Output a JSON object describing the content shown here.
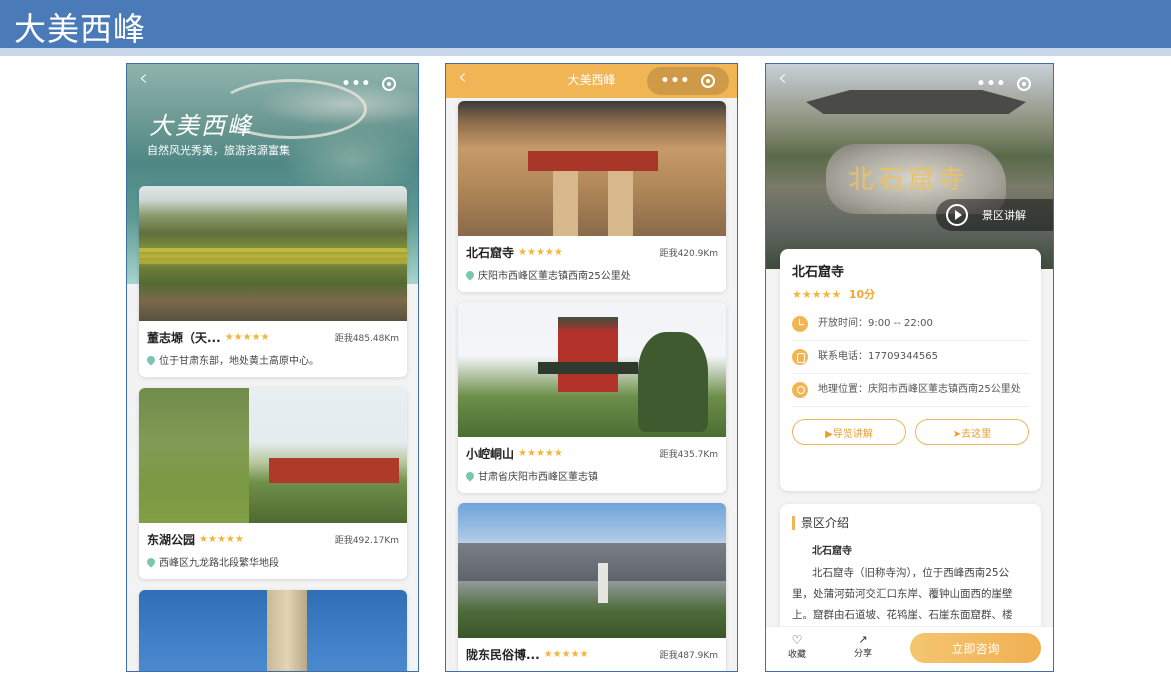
{
  "banner": {
    "title": "大美西峰"
  },
  "phone1": {
    "hero_title": "大美西峰",
    "hero_subtitle": "自然风光秀美，旅游资源富集",
    "menu_dots": "•••",
    "spots": [
      {
        "name": "董志塬（天...",
        "stars": "★★★★★",
        "distance": "距我485.48Km",
        "address": "位于甘肃东部，地处黄土高原中心。"
      },
      {
        "name": "东湖公园",
        "stars": "★★★★★",
        "distance": "距我492.17Km",
        "address": "西峰区九龙路北段繁华地段"
      }
    ]
  },
  "phone2": {
    "nav_title": "大美西峰",
    "menu_dots": "•••",
    "spots": [
      {
        "name": "北石窟寺",
        "stars": "★★★★★",
        "distance": "距我420.9Km",
        "address": "庆阳市西峰区董志镇西南25公里处"
      },
      {
        "name": "小崆峒山",
        "stars": "★★★★★",
        "distance": "距我435.7Km",
        "address": "甘肃省庆阳市西峰区董志镇"
      },
      {
        "name": "陇东民俗博...",
        "stars": "★★★★★",
        "distance": "距我487.9Km",
        "address": ""
      }
    ]
  },
  "phone3": {
    "menu_dots": "•••",
    "audio_label": "景区讲解",
    "rock_text": "北石窟寺",
    "name": "北石窟寺",
    "stars": "★★★★★",
    "score": "10分",
    "open_time": "开放时间：9:00 -- 22:00",
    "phone": "联系电话：17709344565",
    "location": "地理位置：庆阳市西峰区董志镇西南25公里处",
    "guide_button": "▶导览讲解",
    "goto_button": "➤去这里",
    "intro_title": "景区介绍",
    "intro_name": "北石窟寺",
    "intro_text": "北石窟寺（旧称寺沟），位于西峰西南25公里，处蒲河茹河交汇口东岸、覆钟山面西的崖壁上。窟群由石道坡、花鸨崖、石崖东面窟群、楼",
    "fav_label": "收藏",
    "share_label": "分享",
    "consult_button": "立即咨询"
  }
}
